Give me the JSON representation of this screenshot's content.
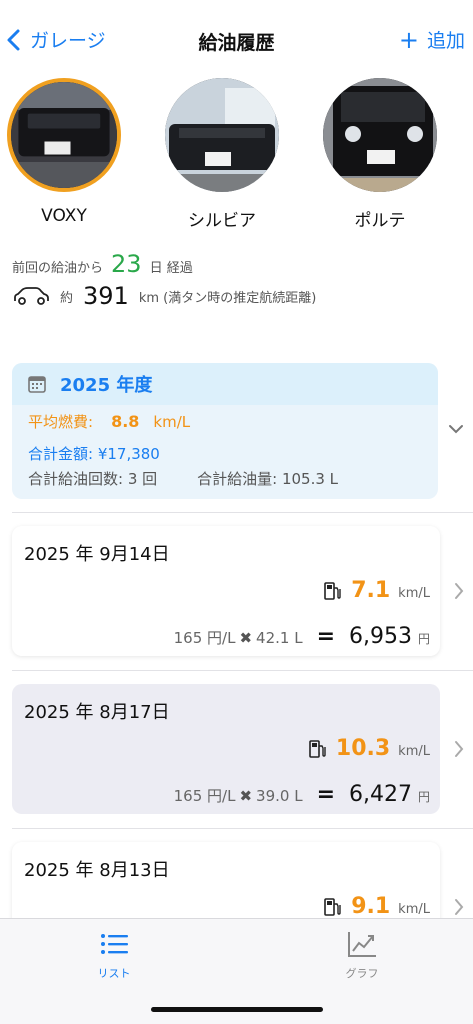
{
  "nav": {
    "back_label": "ガレージ",
    "title": "給油履歴",
    "add_label": "追加"
  },
  "vehicles": [
    {
      "name": "VOXY",
      "selected": true
    },
    {
      "name": "シルビア",
      "selected": false
    },
    {
      "name": "ポルテ",
      "selected": false
    }
  ],
  "stats": {
    "days_prefix": "前回の給油から",
    "days_value": "23",
    "days_suffix": "日 経過",
    "range_prefix": "約",
    "range_value": "391",
    "range_suffix": "km (満タン時の推定航続距離)"
  },
  "year_summary": {
    "title": "2025 年度",
    "avg_label": "平均燃費:",
    "avg_value": "8.8",
    "avg_unit": "km/L",
    "total_amount": "合計金額: ¥17,380",
    "refuel_count": "合計給油回数: 3 回",
    "total_volume": "合計給油量: 105.3 L"
  },
  "records": [
    {
      "date": "2025 年 9月14日",
      "efficiency": "7.1",
      "eff_unit": "km/L",
      "price": "165 円/L",
      "x": "✖",
      "volume": "42.1 L",
      "eq": "=",
      "amount": "6,953",
      "yen": "円"
    },
    {
      "date": "2025 年 8月17日",
      "efficiency": "10.3",
      "eff_unit": "km/L",
      "price": "165 円/L",
      "x": "✖",
      "volume": "39.0 L",
      "eq": "=",
      "amount": "6,427",
      "yen": "円"
    },
    {
      "date": "2025 年 8月13日",
      "efficiency": "9.1",
      "eff_unit": "km/L"
    }
  ],
  "tabs": [
    {
      "label": "リスト",
      "active": true
    },
    {
      "label": "グラフ",
      "active": false
    }
  ],
  "colors": {
    "accent_blue": "#1a7ef0",
    "efficiency_orange": "#f29316",
    "days_green": "#2aa84a",
    "selected_ring": "#f0a020"
  }
}
